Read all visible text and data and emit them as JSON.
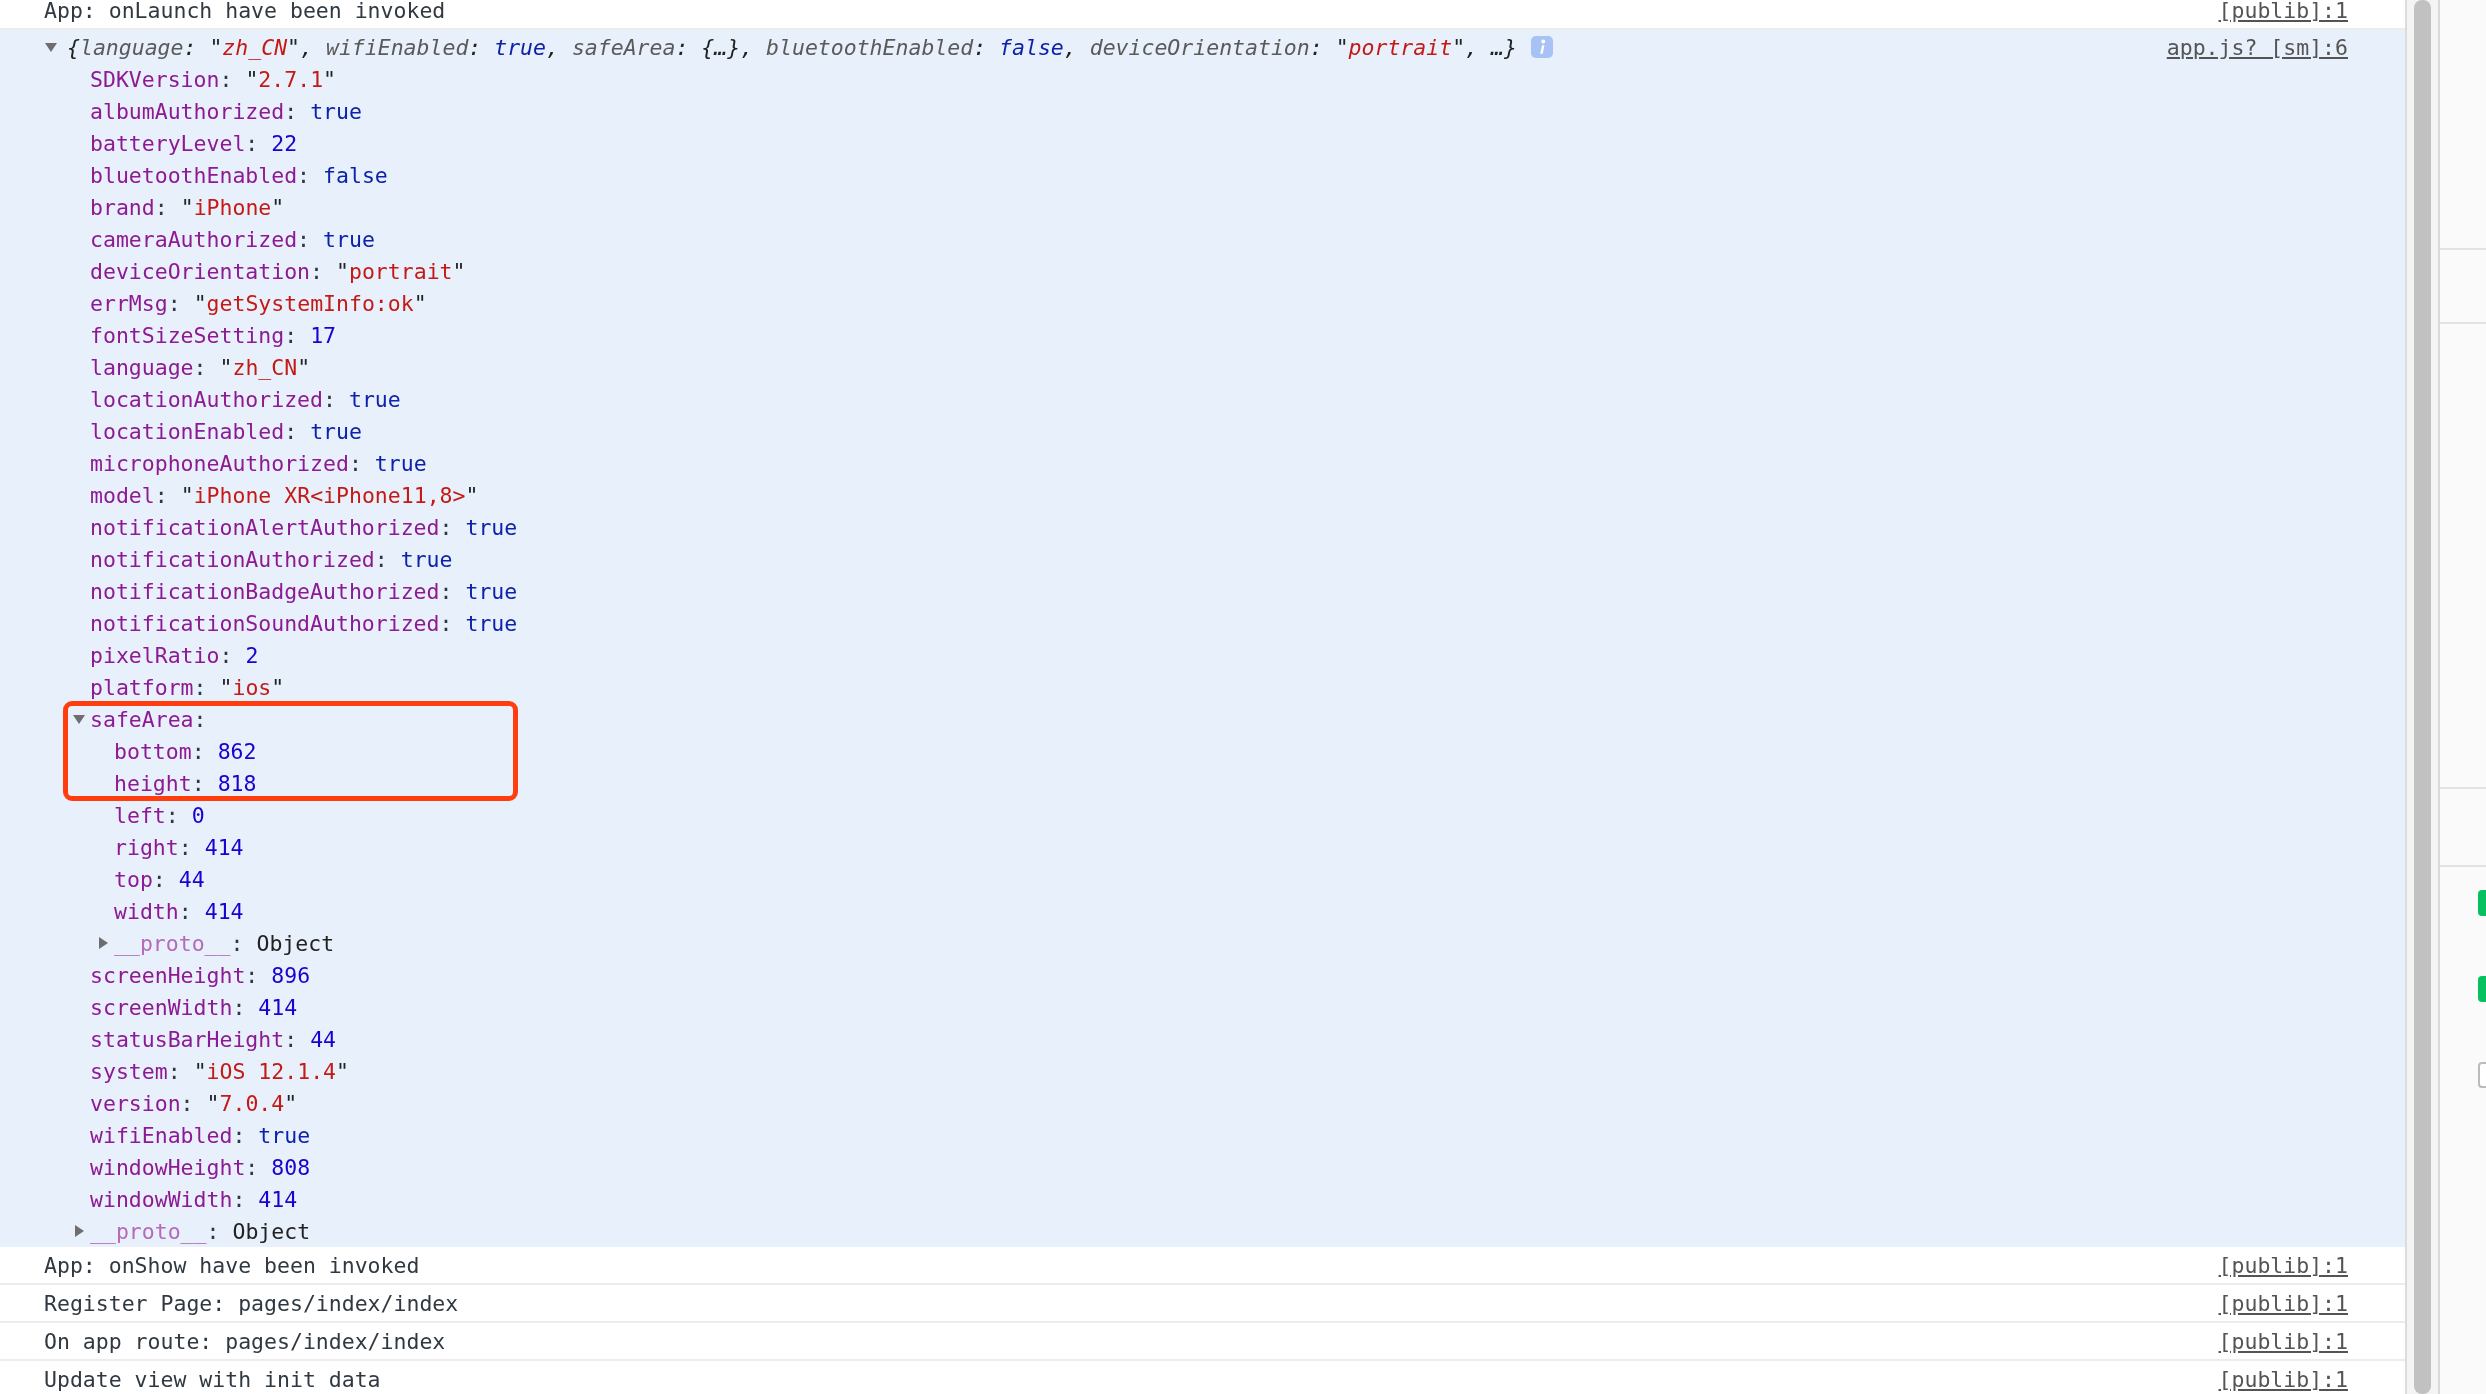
{
  "console": {
    "messages": [
      {
        "kind": "log",
        "text": "App: onLaunch have been invoked",
        "source": "[publib]:1"
      },
      {
        "kind": "object",
        "expanded": true,
        "source": "app.js? [sm]:6",
        "summary": [
          {
            "kind": "punct",
            "text": "{"
          },
          {
            "kind": "key",
            "text": "language"
          },
          {
            "kind": "punct",
            "text": ": "
          },
          {
            "kind": "string",
            "text": "\"zh_CN\""
          },
          {
            "kind": "punct",
            "text": ", "
          },
          {
            "kind": "key",
            "text": "wifiEnabled"
          },
          {
            "kind": "punct",
            "text": ": "
          },
          {
            "kind": "boolean",
            "text": "true"
          },
          {
            "kind": "punct",
            "text": ", "
          },
          {
            "kind": "key",
            "text": "safeArea"
          },
          {
            "kind": "punct",
            "text": ": {…}, "
          },
          {
            "kind": "key",
            "text": "bluetoothEnabled"
          },
          {
            "kind": "punct",
            "text": ": "
          },
          {
            "kind": "boolean",
            "text": "false"
          },
          {
            "kind": "punct",
            "text": ", "
          },
          {
            "kind": "key",
            "text": "deviceOrientation"
          },
          {
            "kind": "punct",
            "text": ": "
          },
          {
            "kind": "string",
            "text": "\"portrait\""
          },
          {
            "kind": "punct",
            "text": ", …}"
          }
        ],
        "properties": [
          {
            "key": "SDKVersion:",
            "kind": "string",
            "value": "\"2.7.1\""
          },
          {
            "key": "albumAuthorized:",
            "kind": "boolean",
            "value": "true"
          },
          {
            "key": "batteryLevel:",
            "kind": "number",
            "value": "22"
          },
          {
            "key": "bluetoothEnabled:",
            "kind": "boolean",
            "value": "false"
          },
          {
            "key": "brand:",
            "kind": "string",
            "value": "\"iPhone\""
          },
          {
            "key": "cameraAuthorized:",
            "kind": "boolean",
            "value": "true"
          },
          {
            "key": "deviceOrientation:",
            "kind": "string",
            "value": "\"portrait\""
          },
          {
            "key": "errMsg:",
            "kind": "string",
            "value": "\"getSystemInfo:ok\""
          },
          {
            "key": "fontSizeSetting:",
            "kind": "number",
            "value": "17"
          },
          {
            "key": "language:",
            "kind": "string",
            "value": "\"zh_CN\""
          },
          {
            "key": "locationAuthorized:",
            "kind": "boolean",
            "value": "true"
          },
          {
            "key": "locationEnabled:",
            "kind": "boolean",
            "value": "true"
          },
          {
            "key": "microphoneAuthorized:",
            "kind": "boolean",
            "value": "true"
          },
          {
            "key": "model:",
            "kind": "string",
            "value": "\"iPhone XR<iPhone11,8>\""
          },
          {
            "key": "notificationAlertAuthorized:",
            "kind": "boolean",
            "value": "true"
          },
          {
            "key": "notificationAuthorized:",
            "kind": "boolean",
            "value": "true"
          },
          {
            "key": "notificationBadgeAuthorized:",
            "kind": "boolean",
            "value": "true"
          },
          {
            "key": "notificationSoundAuthorized:",
            "kind": "boolean",
            "value": "true"
          },
          {
            "key": "pixelRatio:",
            "kind": "number",
            "value": "2"
          },
          {
            "key": "platform:",
            "kind": "string",
            "value": "\"ios\""
          },
          {
            "key": "safeArea:",
            "kind": "object",
            "expanded": true,
            "highlighted": true,
            "children": [
              {
                "key": "bottom:",
                "kind": "number",
                "value": "862"
              },
              {
                "key": "height:",
                "kind": "number",
                "value": "818"
              },
              {
                "key": "left:",
                "kind": "number",
                "value": "0"
              },
              {
                "key": "right:",
                "kind": "number",
                "value": "414"
              },
              {
                "key": "top:",
                "kind": "number",
                "value": "44"
              },
              {
                "key": "width:",
                "kind": "number",
                "value": "414"
              },
              {
                "key": "__proto__:",
                "kind": "proto",
                "expanded": false,
                "value": "Object"
              }
            ]
          },
          {
            "key": "screenHeight:",
            "kind": "number",
            "value": "896"
          },
          {
            "key": "screenWidth:",
            "kind": "number",
            "value": "414"
          },
          {
            "key": "statusBarHeight:",
            "kind": "number",
            "value": "44"
          },
          {
            "key": "system:",
            "kind": "string",
            "value": "\"iOS 12.1.4\""
          },
          {
            "key": "version:",
            "kind": "string",
            "value": "\"7.0.4\""
          },
          {
            "key": "wifiEnabled:",
            "kind": "boolean",
            "value": "true"
          },
          {
            "key": "windowHeight:",
            "kind": "number",
            "value": "808"
          },
          {
            "key": "windowWidth:",
            "kind": "number",
            "value": "414"
          },
          {
            "key": "__proto__:",
            "kind": "proto",
            "expanded": false,
            "value": "Object"
          }
        ]
      },
      {
        "kind": "log",
        "text": "App: onShow have been invoked",
        "source": "[publib]:1"
      },
      {
        "kind": "log",
        "text": "Register Page: pages/index/index",
        "source": "[publib]:1"
      },
      {
        "kind": "log",
        "text": "On app route: pages/index/index",
        "source": "[publib]:1"
      },
      {
        "kind": "log",
        "text": "Update view with init data",
        "source": "[publib]:1"
      }
    ]
  },
  "side_panel": {
    "checkboxes": [
      {
        "checked": true
      },
      {
        "checked": true
      },
      {
        "checked": false
      }
    ]
  }
}
